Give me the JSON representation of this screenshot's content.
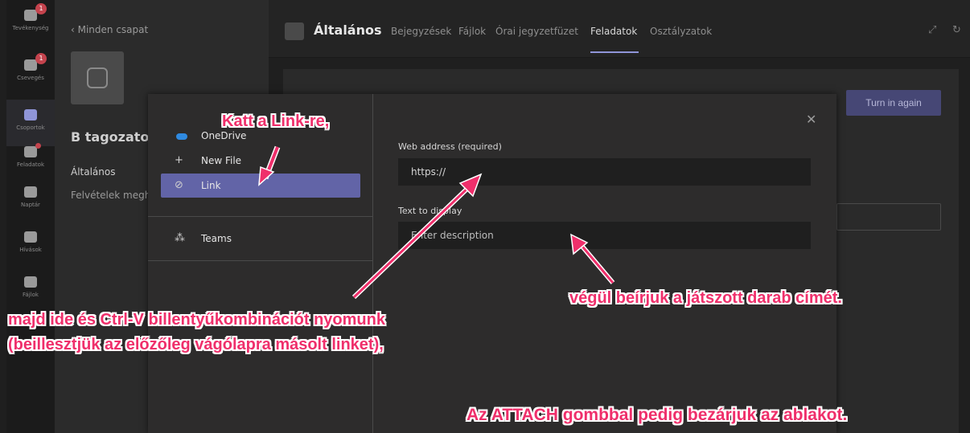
{
  "rail": {
    "items": [
      {
        "label": "Tevékenység",
        "badge": "1"
      },
      {
        "label": "Csevegés",
        "badge": "1"
      },
      {
        "label": "Csoportok"
      },
      {
        "label": "Feladatok"
      },
      {
        "label": "Naptár"
      },
      {
        "label": "Hívások"
      },
      {
        "label": "Fájlok"
      }
    ]
  },
  "teamcol": {
    "back": "‹  Minden csapat",
    "team_name": "B tagozatos",
    "channels": [
      "Általános",
      "Felvételek megh"
    ]
  },
  "header": {
    "title": "Általános",
    "tabs": [
      "Bejegyzések",
      "Fájlok",
      "Órai jegyzetfüzet",
      "Feladatok",
      "Osztályzatok"
    ],
    "selected_tab": "Feladatok"
  },
  "content": {
    "turn_in_label": "Turn in again"
  },
  "dialog": {
    "options": [
      {
        "label": "OneDrive",
        "icon": "cloud-icon"
      },
      {
        "label": "New File",
        "icon": "plus-icon"
      },
      {
        "label": "Link",
        "icon": "link-icon"
      },
      {
        "label": "Teams",
        "icon": "teams-icon"
      }
    ],
    "selected_option": "Link",
    "web_address_label": "Web address (required)",
    "web_address_value": "https://",
    "text_to_display_label": "Text to display",
    "text_to_display_placeholder": "Enter description",
    "close_glyph": "✕"
  },
  "annotations": {
    "link": "Katt a Link-re,",
    "paste_line1": "majd ide és Ctrl-V billentyűkombinációt nyomunk",
    "paste_line2": "(beillesztjük az előzőleg vágólapra másolt linket),",
    "title": "végül beírjuk a játszott darab címét.",
    "attach": "Az ATTACH gombbal pedig bezárjuk az ablakot."
  },
  "colors": {
    "accent": "#6264a7",
    "annotation": "#ef2f6b",
    "badge": "#c4434d"
  }
}
